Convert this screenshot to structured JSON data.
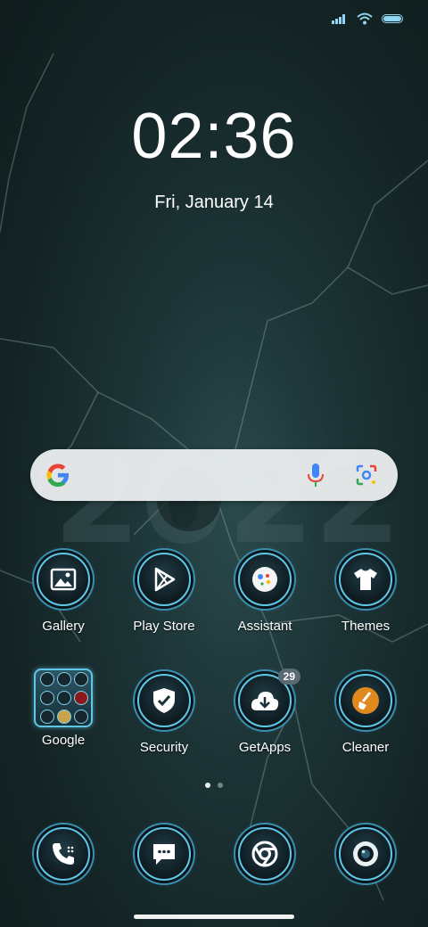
{
  "status_bar": {
    "signal_icon": "cellular-signal-icon",
    "wifi_icon": "wifi-icon",
    "battery_icon": "battery-icon",
    "battery_level": 0.9
  },
  "lock": {
    "time": "02:36",
    "date": "Fri, January 14"
  },
  "search": {
    "google_icon": "google-g-icon",
    "mic_icon": "mic-icon",
    "lens_icon": "lens-icon"
  },
  "apps_row1": [
    {
      "label": "Gallery",
      "icon": "gallery-icon"
    },
    {
      "label": "Play Store",
      "icon": "play-store-icon"
    },
    {
      "label": "Assistant",
      "icon": "assistant-icon"
    },
    {
      "label": "Themes",
      "icon": "themes-icon"
    }
  ],
  "apps_row2": [
    {
      "label": "Google",
      "icon": "google-folder-icon"
    },
    {
      "label": "Security",
      "icon": "security-icon"
    },
    {
      "label": "GetApps",
      "icon": "getapps-icon",
      "badge": "29"
    },
    {
      "label": "Cleaner",
      "icon": "cleaner-icon"
    }
  ],
  "dock": [
    {
      "icon": "phone-icon"
    },
    {
      "icon": "messages-icon"
    },
    {
      "icon": "chrome-icon"
    },
    {
      "icon": "camera-icon"
    }
  ],
  "page_indicator": {
    "pages": 2,
    "current": 1
  },
  "colors": {
    "accent": "#5fc6e6",
    "background": "#1c3335"
  }
}
